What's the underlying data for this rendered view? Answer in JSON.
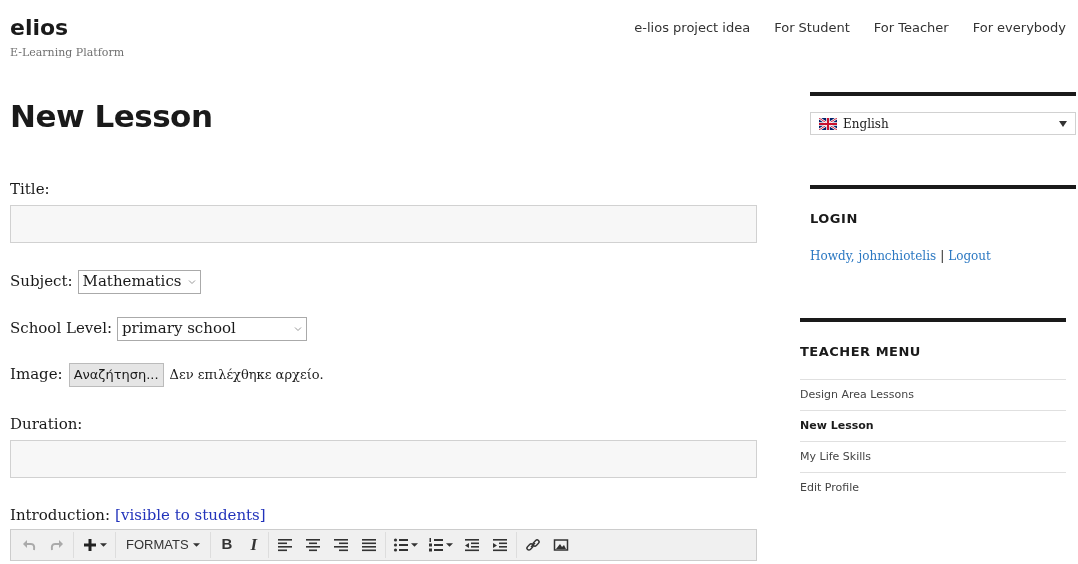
{
  "site": {
    "title": "elios",
    "tagline": "E-Learning Platform"
  },
  "nav": [
    {
      "label": "e-lios project idea"
    },
    {
      "label": "For Student"
    },
    {
      "label": "For Teacher"
    },
    {
      "label": "For everybody"
    }
  ],
  "page_title": "New Lesson",
  "form": {
    "title_label": "Title:",
    "subject": {
      "label": "Subject:",
      "value": "Mathematics"
    },
    "school_level": {
      "label": "School Level:",
      "value": "primary school"
    },
    "image": {
      "label": "Image:",
      "button": "Αναζήτηση...",
      "status": "Δεν επιλέχθηκε αρχείο."
    },
    "duration_label": "Duration:",
    "introduction": {
      "label": "Introduction:",
      "note": "[visible to students]"
    },
    "toolbar": {
      "undo_disabled": true,
      "redo_disabled": true,
      "formats": "FORMATS",
      "bold": "B",
      "italic": "I"
    }
  },
  "sidebar": {
    "language": {
      "value": "English"
    },
    "login": {
      "heading": "LOGIN",
      "greeting": "Howdy, johnchiotelis",
      "separator": "|",
      "logout": "Logout"
    },
    "teacher_menu": {
      "heading": "TEACHER MENU",
      "items": [
        {
          "label": "Design Area Lessons",
          "selected": false
        },
        {
          "label": "New Lesson",
          "selected": true
        },
        {
          "label": "My Life Skills",
          "selected": false
        },
        {
          "label": "Edit Profile",
          "selected": false
        }
      ]
    }
  }
}
